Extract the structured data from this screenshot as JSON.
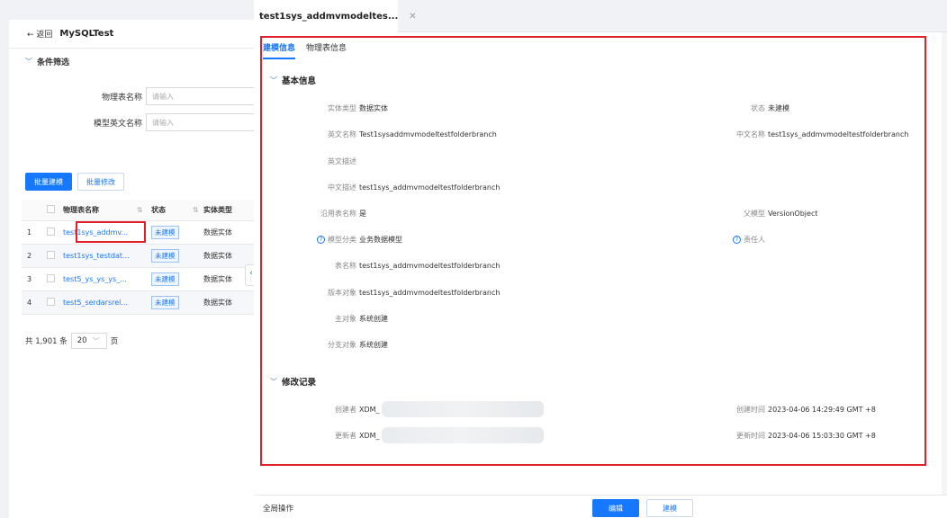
{
  "left": {
    "back_label": "← 返回",
    "project": "MySQLTest",
    "filter_title": "条件筛选",
    "filters": [
      {
        "label": "物理表名称",
        "placeholder": "请输入"
      },
      {
        "label": "模型英文名称",
        "placeholder": "请输入"
      }
    ],
    "batch_build": "批量建模",
    "batch_edit": "批量修改",
    "table": {
      "headers": {
        "name": "物理表名称",
        "status": "状态",
        "type": "实体类型"
      },
      "rows": [
        {
          "no": "1",
          "name": "test1sys_addmv...",
          "status": "未建模",
          "type": "数据实体"
        },
        {
          "no": "2",
          "name": "test1sys_testdat...",
          "status": "未建模",
          "type": "数据实体"
        },
        {
          "no": "3",
          "name": "test5_ys_ys_ys_...",
          "status": "未建模",
          "type": "数据实体"
        },
        {
          "no": "4",
          "name": "test5_serdarsrel...",
          "status": "未建模",
          "type": "数据实体"
        }
      ]
    },
    "pager": {
      "total": "共 1,901 条",
      "size": "20",
      "unit": "页"
    }
  },
  "detail": {
    "tab_title": "test1sys_addmvmodeltes...",
    "subtabs": [
      "建模信息",
      "物理表信息"
    ],
    "basic_title": "基本信息",
    "fields_left": [
      {
        "k": "实体类型",
        "v": "数据实体"
      },
      {
        "k": "英文名称",
        "v": "Test1sysaddmvmodeltestfolderbranch"
      },
      {
        "k": "英文描述",
        "v": ""
      },
      {
        "k": "中文描述",
        "v": "test1sys_addmvmodeltestfolderbranch"
      },
      {
        "k": "沿用表名称",
        "v": "是"
      },
      {
        "k": "模型分类",
        "v": "业务数据模型"
      },
      {
        "k": "表名称",
        "v": "test1sys_addmvmodeltestfolderbranch"
      },
      {
        "k": "版本对象",
        "v": "test1sys_addmvmodeltestfolderbranch"
      },
      {
        "k": "主对象",
        "v": "系统创建"
      },
      {
        "k": "分支对象",
        "v": "系统创建"
      }
    ],
    "fields_right": [
      {
        "k": "状态",
        "v": "未建模"
      },
      {
        "k": "中文名称",
        "v": "test1sys_addmvmodeltestfolderbranch"
      },
      {
        "k": "父模型",
        "v": "VersionObject"
      },
      {
        "k": "责任人",
        "v": ""
      }
    ],
    "history_title": "修改记录",
    "history": [
      {
        "k": "创建者",
        "v": "XDM_",
        "tk": "创建时间",
        "tv": "2023-04-06 14:29:49 GMT +8"
      },
      {
        "k": "更新者",
        "v": "XDM_",
        "tk": "更新时间",
        "tv": "2023-04-06 15:03:30 GMT +8"
      }
    ],
    "footer": {
      "global": "全局操作",
      "edit": "编辑",
      "build": "建模"
    }
  }
}
